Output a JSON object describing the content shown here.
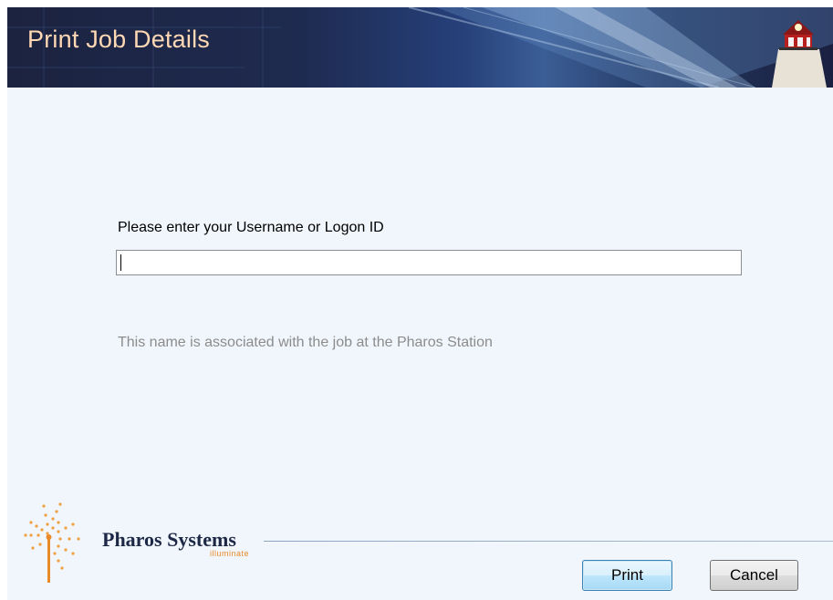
{
  "dialog": {
    "title": "Print Job Details"
  },
  "form": {
    "prompt_label": "Please enter your Username or Logon ID",
    "username_value": "",
    "hint": "This name is associated with the job at the Pharos Station"
  },
  "branding": {
    "name": "Pharos Systems",
    "tagline": "illuminate",
    "logo_icon": "sunburst-icon",
    "banner_image": "lighthouse-icon"
  },
  "buttons": {
    "print_label": "Print",
    "cancel_label": "Cancel"
  },
  "colors": {
    "banner_dark": "#1c2340",
    "title_text": "#ffd8b4",
    "window_bg": "#f1f6fc",
    "hint_text": "#8c8c8c",
    "brand_orange": "#e8892a"
  }
}
